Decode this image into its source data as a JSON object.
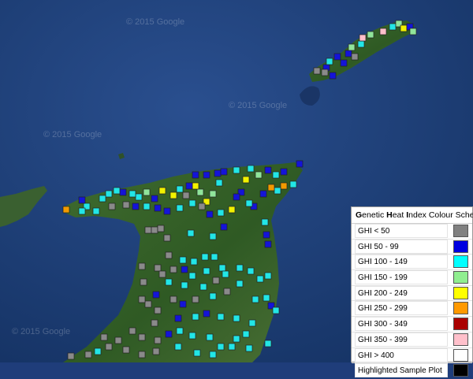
{
  "map": {
    "watermark": "© 2015 Google",
    "categories": [
      {
        "id": "lt50",
        "color": "#8a8a8a"
      },
      {
        "id": "50_99",
        "color": "#1414d8"
      },
      {
        "id": "100_149",
        "color": "#22e6e6"
      },
      {
        "id": "150_199",
        "color": "#90e59a"
      },
      {
        "id": "200_249",
        "color": "#f2f200"
      },
      {
        "id": "250_299",
        "color": "#f29a00"
      },
      {
        "id": "300_349",
        "color": "#a00000"
      },
      {
        "id": "350_399",
        "color": "#ffc0cb"
      },
      {
        "id": "gt400",
        "color": "#ffffff"
      }
    ]
  },
  "legend": {
    "title_g": "G",
    "title_1": "enetic ",
    "title_h": "H",
    "title_2": "eat ",
    "title_i": "I",
    "title_3": "ndex Colour Scheme",
    "rows": [
      {
        "label": "GHI < 50",
        "color": "#808080"
      },
      {
        "label": "GHI 50 - 99",
        "color": "#0000e0"
      },
      {
        "label": "GHI 100 - 149",
        "color": "#00ffff"
      },
      {
        "label": "GHI 150 - 199",
        "color": "#90ee90"
      },
      {
        "label": "GHI 200 - 249",
        "color": "#ffff00"
      },
      {
        "label": "GHI 250 - 299",
        "color": "#ff9900"
      },
      {
        "label": "GHI 300 - 349",
        "color": "#aa0000"
      },
      {
        "label": "GHI 350 - 399",
        "color": "#ffc0cb"
      },
      {
        "label": "GHI > 400",
        "color": "#ffffff"
      },
      {
        "label": "Highlighted Sample Plot",
        "color": "#000000"
      }
    ]
  }
}
